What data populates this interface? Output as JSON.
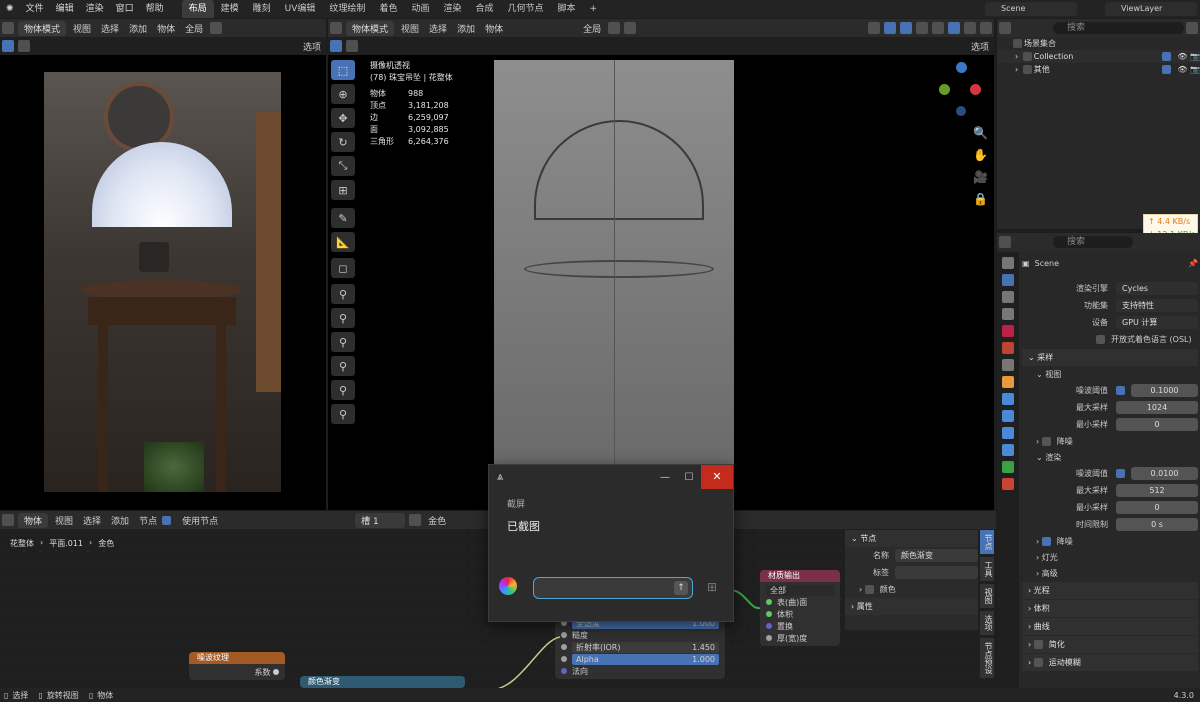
{
  "menu": [
    "文件",
    "编辑",
    "渲染",
    "窗口",
    "帮助"
  ],
  "workspaces": [
    "布局",
    "建模",
    "雕刻",
    "UV编辑",
    "纹理绘制",
    "着色",
    "动画",
    "渲染",
    "合成",
    "几何节点",
    "脚本"
  ],
  "workspace_add": "+",
  "scene_name": "Scene",
  "view_layer": "ViewLayer",
  "left_view": {
    "mode": "物体模式",
    "menu": [
      "视图",
      "选择",
      "添加",
      "物体"
    ],
    "transform": "全局",
    "select_label": "选项"
  },
  "right_view": {
    "mode": "物体模式",
    "menu": [
      "视图",
      "选择",
      "添加",
      "物体"
    ],
    "transform": "全局",
    "select_label": "选项"
  },
  "stats": {
    "title": "摄像机透视",
    "subtitle": "(78) 珠宝吊坠 | 花整体",
    "rows": [
      [
        "物体",
        "988"
      ],
      [
        "顶点",
        "3,181,208"
      ],
      [
        "边",
        "6,259,097"
      ],
      [
        "面",
        "3,092,885"
      ],
      [
        "三角形",
        "6,264,376"
      ]
    ]
  },
  "outliner": {
    "search_placeholder": "搜索",
    "root": "场景集合",
    "items": [
      "Collection",
      "其他"
    ]
  },
  "network": {
    "up": "↑ 4.4 KB/s",
    "down": "↓ 12.1 KB/s"
  },
  "properties": {
    "search_placeholder": "搜索",
    "scene": "Scene",
    "render_engine_label": "渲染引擎",
    "render_engine": "Cycles",
    "feature_set_label": "功能集",
    "feature_set": "支持特性",
    "device_label": "设备",
    "device": "GPU 计算",
    "osl_label": "开放式着色语言 (OSL)",
    "sampling": "采样",
    "viewport": "视图",
    "vp_noise_label": "噪波阈值",
    "vp_noise": "0.1000",
    "vp_max_label": "最大采样",
    "vp_max": "1024",
    "vp_min_label": "最小采样",
    "vp_min": "0",
    "denoise": "降噪",
    "render": "渲染",
    "r_noise_label": "噪波阈值",
    "r_noise": "0.0100",
    "r_max_label": "最大采样",
    "r_max": "512",
    "r_min_label": "最小采样",
    "r_min": "0",
    "r_time_label": "时间限制",
    "r_time": "0 s",
    "denoise2": "降噪",
    "lights": "灯光",
    "advanced": "高级",
    "sections": [
      "光程",
      "体积",
      "曲线",
      "简化",
      "运动模糊"
    ]
  },
  "node_editor": {
    "mode": "物体",
    "menu": [
      "视图",
      "选择",
      "添加",
      "节点"
    ],
    "use_nodes": "使用节点",
    "slot": "槽 1",
    "material": "金色",
    "breadcrumb": [
      "花整体",
      "平面.011",
      "金色"
    ]
  },
  "nodes": {
    "noise": {
      "title": "噪波纹理",
      "row": "系数"
    },
    "color_ramp": {
      "title": "颜色渐变"
    },
    "output": {
      "title": "材质输出",
      "target": "全部",
      "sockets": [
        "表(曲)面",
        "体积",
        "置换",
        "厚(宽)度"
      ]
    },
    "bsdf": {
      "transmission_label": "全透度",
      "transmission": "1.000",
      "roughness": "糙度",
      "ior_label": "折射率(IOR)",
      "ior": "1.450",
      "alpha_label": "Alpha",
      "alpha": "1.000",
      "normal": "法向"
    }
  },
  "node_panel": {
    "section": "节点",
    "name_label": "名称",
    "name": "颜色渐变",
    "label_label": "标签",
    "color": "颜色",
    "props": "属性",
    "tabs": [
      "节点",
      "工具",
      "视图",
      "选项",
      "节点预设"
    ]
  },
  "dialog": {
    "app_title": "截屏",
    "message": "已截图"
  },
  "statusbar": {
    "items": [
      "选择",
      "旋转视图",
      "物体"
    ],
    "version": "4.3.0"
  }
}
